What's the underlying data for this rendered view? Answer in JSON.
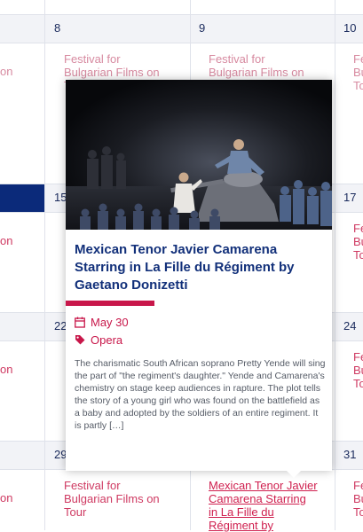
{
  "calendar": {
    "days": [
      "8",
      "9",
      "10",
      "15",
      "17",
      "22",
      "24",
      "29",
      "31"
    ],
    "events": {
      "on": "on",
      "festival": "Festival for\nBulgarian Films on\nTour",
      "festival_trunc": "Fe\nBu\nTo",
      "mexican_link": "Mexican Tenor Javier\nCamarena Starring\nin La Fille du\nRégiment by"
    }
  },
  "popup": {
    "title": "Mexican Tenor Javier Camarena Starring in La Fille du Régiment by Gaetano Donizetti",
    "date": "May 30",
    "category": "Opera",
    "description": "The charismatic South African soprano Pretty Yende will sing the part of \"the regiment's daughter.\" Yende and Camarena's chemistry on stage keep audiences in rapture. The plot tells the story of a young girl who was found on the battlefield as a baby and adopted by the soldiers of an entire regiment. It is partly […]",
    "icons": {
      "date": "calendar-icon",
      "category": "tag-icon"
    },
    "colors": {
      "accent": "#c8174a",
      "title": "#12307a"
    }
  }
}
